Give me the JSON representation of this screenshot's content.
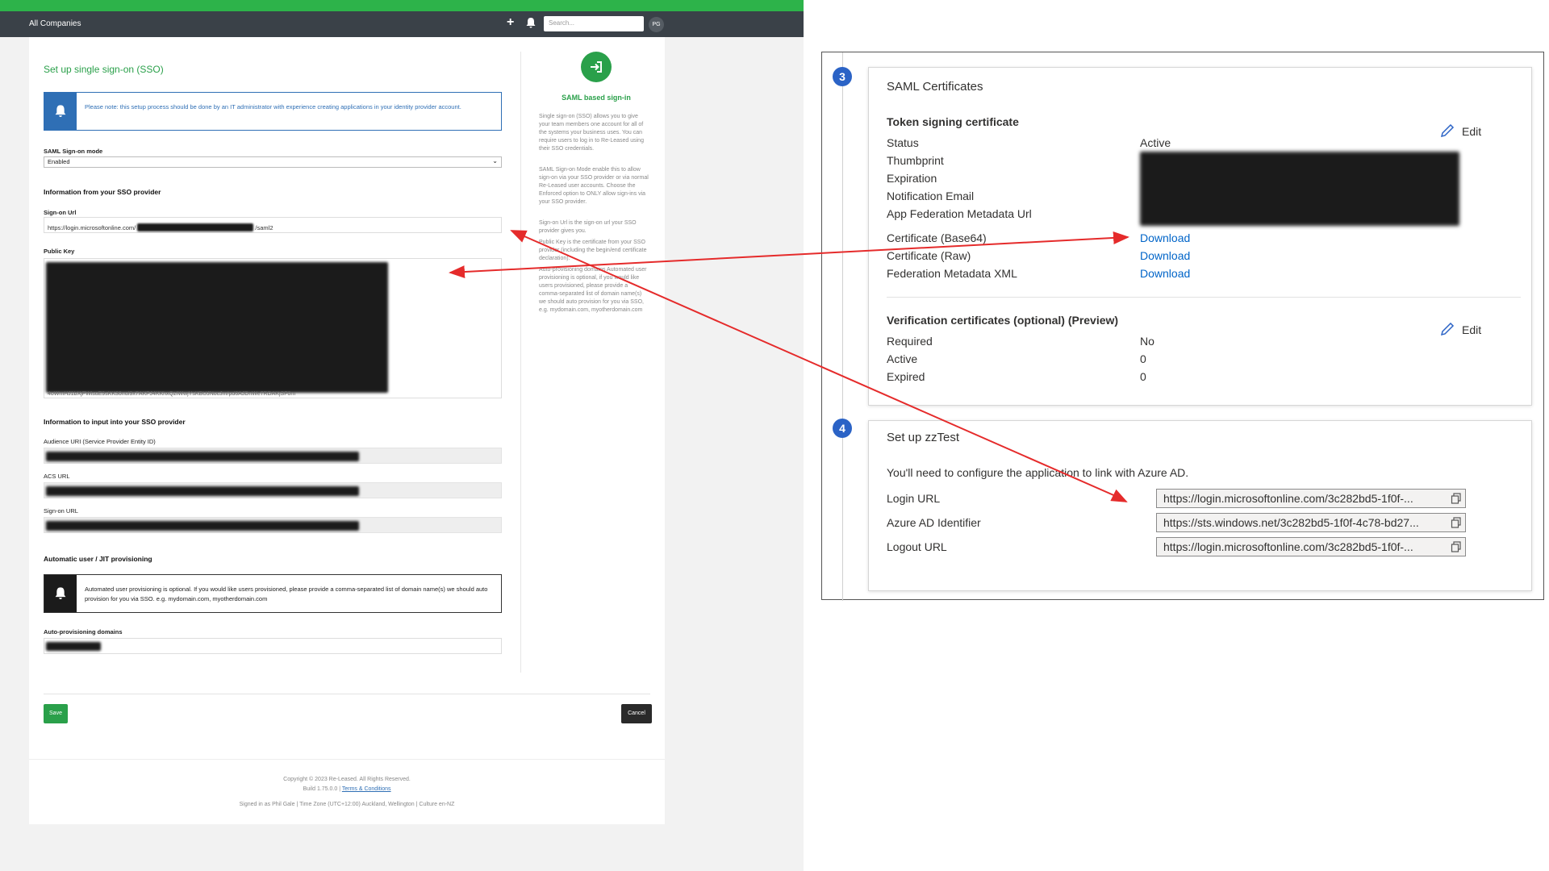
{
  "app": {
    "topnav": {
      "company": "All Companies",
      "search_placeholder": "Search...",
      "avatar": "PG"
    },
    "title": "Set up single sign-on (SSO)",
    "notice": "Please note: this setup process should be done by an IT administrator with experience creating applications in your identity provider account.",
    "saml_mode": {
      "label": "SAML Sign-on mode",
      "value": "Enabled"
    },
    "from_provider": {
      "heading": "Information from your SSO provider",
      "signon_label": "Sign-on Url",
      "signon_prefix": "https://login.microsoftonline.com/",
      "signon_suffix": "/saml2",
      "public_key_label": "Public Key",
      "public_key_tail": "4oWmHJ1bXjFWlsuE9sKK30nuf9x7AKFJ4KKhxQzIWwjYsKBUJNocJm/pd6AJDnWe7RDAKjSF0m"
    },
    "to_provider": {
      "heading": "Information to input into your SSO provider",
      "audience_label": "Audience URI (Service Provider Entity ID)",
      "acs_label": "ACS URL",
      "signon_label": "Sign-on URL"
    },
    "jit": {
      "heading": "Automatic user / JIT provisioning",
      "notice": "Automated user provisioning is optional. If you would like users provisioned, please provide a comma-separated list of domain name(s) we should auto provision for you via SSO. e.g. mydomain.com, myotherdomain.com",
      "domains_label": "Auto-provisioning domains"
    },
    "buttons": {
      "save": "Save",
      "cancel": "Cancel"
    },
    "footer": {
      "copyright": "Copyright © 2023 Re-Leased. All Rights Reserved.",
      "build": "Build 1.75.0.0",
      "terms": "Terms & Conditions",
      "signed_in": "Signed in as Phil Gale",
      "timezone": "Time Zone (UTC+12:00) Auckland, Wellington",
      "culture": "Culture en-NZ"
    },
    "sidebar": {
      "heading": "SAML based sign-in",
      "p1": "Single sign-on (SSO) allows you to give your team members one account for all of the systems your business uses. You can require users to log in to Re-Leased using their SSO credentials.",
      "p2": "SAML Sign-on Mode enable this to allow sign-on via your SSO provider or via normal Re-Leased user accounts. Choose the Enforced option to ONLY allow sign-ins via your SSO provider.",
      "p3": "Sign-on Url is the sign-on url your SSO provider gives you.",
      "p4": "Public Key is the certificate from your SSO provider (including the begin/end certificate declaration).",
      "p5": "Auto-provisioning domains Automated user provisioning is optional, if you would like users provisioned, please provide a comma-separated list of domain name(s) we should auto provision for you via SSO, e.g. mydomain.com, myotherdomain.com"
    }
  },
  "azure": {
    "step3": {
      "number": "3",
      "title": "SAML Certificates",
      "token_heading": "Token signing certificate",
      "edit": "Edit",
      "rows": [
        {
          "k": "Status",
          "v": "Active"
        },
        {
          "k": "Thumbprint"
        },
        {
          "k": "Expiration"
        },
        {
          "k": "Notification Email"
        },
        {
          "k": "App Federation Metadata Url"
        }
      ],
      "downloads": [
        {
          "k": "Certificate (Base64)",
          "v": "Download"
        },
        {
          "k": "Certificate (Raw)",
          "v": "Download"
        },
        {
          "k": "Federation Metadata XML",
          "v": "Download"
        }
      ],
      "verif_heading": "Verification certificates (optional) (Preview)",
      "verif_edit": "Edit",
      "verif_rows": [
        {
          "k": "Required",
          "v": "No"
        },
        {
          "k": "Active",
          "v": "0"
        },
        {
          "k": "Expired",
          "v": "0"
        }
      ]
    },
    "step4": {
      "number": "4",
      "title": "Set up zzTest",
      "desc": "You'll need to configure the application to link with Azure AD.",
      "urls": [
        {
          "k": "Login URL",
          "v": "https://login.microsoftonline.com/3c282bd5-1f0f-..."
        },
        {
          "k": "Azure AD Identifier",
          "v": "https://sts.windows.net/3c282bd5-1f0f-4c78-bd27..."
        },
        {
          "k": "Logout URL",
          "v": "https://login.microsoftonline.com/3c282bd5-1f0f-..."
        }
      ]
    }
  },
  "colors": {
    "brand_green": "#2aa04a",
    "azure_blue": "#2b63c6",
    "arrow_red": "#e52b2b"
  }
}
